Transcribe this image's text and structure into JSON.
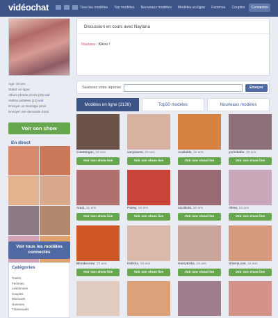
{
  "brand": {
    "logo": "vidéochat"
  },
  "nav": [
    {
      "label": "Tous les modèles",
      "active": false
    },
    {
      "label": "Top modèles",
      "active": false
    },
    {
      "label": "Nouveaux modèles",
      "active": false
    },
    {
      "label": "Modèles en ligne",
      "active": false
    },
    {
      "label": "Femmes",
      "active": false
    },
    {
      "label": "Couples",
      "active": false
    },
    {
      "label": "Connexion",
      "active": true
    }
  ],
  "sidebar": {
    "info": {
      "age": "Age: 19 ans",
      "status": "Statut: en ligne",
      "album": "Album photos privés (20)",
      "album_link": "voir",
      "videos": "Vidéos publiées (13)",
      "videos_link": "voir",
      "send_msg": "Envoyer un message privé",
      "send_friend": "Envoyer une demande d'ami"
    },
    "show_button": "Voir son show",
    "live_title": "En direct",
    "live_colors": [
      "#d88a6c",
      "#c9785a",
      "#e3b28e",
      "#d9a98b",
      "#8c7b86",
      "#b1896f",
      "#d4a1b4",
      "#e0a36b"
    ],
    "all_button": "Voir tous les modèles connectés",
    "categories_title": "Catégories",
    "categories": [
      "Toutes",
      "Femmes",
      "Lesbiennes",
      "Couples",
      "Bisexuels",
      "Hommes",
      "Transexuels"
    ]
  },
  "chat": {
    "header": "Discussion en cours avec Naytana",
    "message_nick": "Naytana",
    "message_sep": " : ",
    "message_text": "Kikoo !"
  },
  "reply": {
    "label": "Saisissez votre réponse",
    "placeholder": "",
    "button": "Envoyer"
  },
  "tabs": [
    {
      "label": "Modèles en ligne (2139)",
      "active": true
    },
    {
      "label": "Top50 modèles",
      "active": false
    },
    {
      "label": "Nouveaux modèles",
      "active": false
    }
  ],
  "models": [
    {
      "name": "CuteMegan",
      "age": "18 ans",
      "color": "#6b5247"
    },
    {
      "name": "vanysweet",
      "age": "21 ans",
      "color": "#d8b2a1"
    },
    {
      "name": "Available",
      "age": "21 ans",
      "color": "#d7823f"
    },
    {
      "name": "yorimbabe",
      "age": "30 ans",
      "color": "#8c6f78"
    },
    {
      "name": "Arani",
      "age": "21 ans",
      "color": "#b0706d"
    },
    {
      "name": "Pansy",
      "age": "19 ans",
      "color": "#c94438"
    },
    {
      "name": "nicolle26",
      "age": "28 ans",
      "color": "#9a6a72"
    },
    {
      "name": "Alleta",
      "age": "24 ans",
      "color": "#c8a8b8"
    },
    {
      "name": "BlondeAnne",
      "age": "23 ans",
      "color": "#d05826"
    },
    {
      "name": "Delisha",
      "age": "19 ans",
      "color": "#d9b9aa"
    },
    {
      "name": "HornyErika",
      "age": "19 ans",
      "color": "#c9a59c"
    },
    {
      "name": "SherryLove",
      "age": "22 ans",
      "color": "#d69a7e"
    },
    {
      "name": "",
      "age": "",
      "color": "#e2cbbf"
    },
    {
      "name": "",
      "age": "",
      "color": "#dba27a"
    },
    {
      "name": "",
      "age": "",
      "color": "#9f7d8c"
    },
    {
      "name": "",
      "age": "",
      "color": "#d3938a"
    }
  ],
  "card_button": "Voir son show live"
}
